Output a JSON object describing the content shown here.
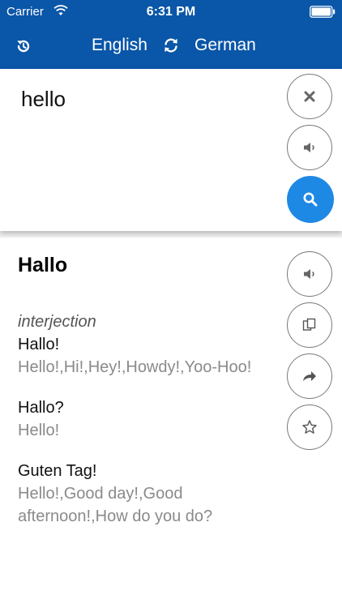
{
  "status_bar": {
    "carrier": "Carrier",
    "time": "6:31 PM",
    "icons": [
      "wifi-icon",
      "battery-icon"
    ]
  },
  "nav": {
    "source_language": "English",
    "target_language": "German",
    "icons": [
      "history-icon",
      "swap-icon"
    ]
  },
  "input": {
    "text": "hello",
    "icons": [
      "clear-icon",
      "speaker-icon",
      "search-icon"
    ]
  },
  "result": {
    "word": "Hallo",
    "part_of_speech": "interjection",
    "entries": [
      {
        "term": "Hallo!",
        "synonyms": "Hello!,Hi!,Hey!,Howdy!,Yoo-Hoo!"
      },
      {
        "term": "Hallo?",
        "synonyms": "Hello!"
      },
      {
        "term": "Guten Tag!",
        "synonyms": "Hello!,Good day!,Good afternoon!,How do you do?"
      }
    ],
    "icons": [
      "speaker-icon",
      "copy-icon",
      "share-icon",
      "star-icon"
    ]
  },
  "colors": {
    "header_blue": "#0a56a8",
    "accent_blue": "#1e88e5",
    "synonym_gray": "#8a8a8a"
  }
}
